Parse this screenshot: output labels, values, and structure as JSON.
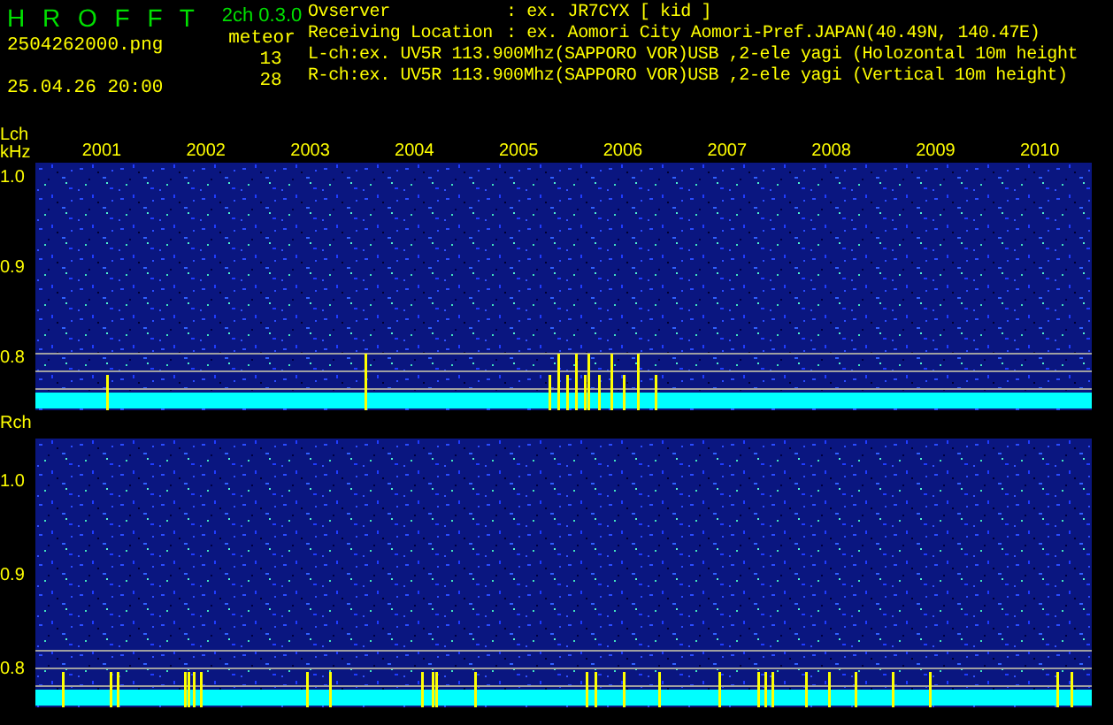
{
  "header": {
    "logo": "H R O F F T",
    "version": "2ch 0.3.0",
    "mode": "meteor",
    "filename": "2504262000.png",
    "timestamp": "25.04.26 20:00",
    "counts": [
      "13",
      "28"
    ]
  },
  "station": [
    {
      "label": "Ovserver",
      "value": ": ex. JR7CYX [ kid ]"
    },
    {
      "label": "Receiving Location",
      "value": ": ex. Aomori City Aomori-Pref.JAPAN(40.49N, 140.47E)"
    }
  ],
  "receivers": [
    "L-ch:ex. UV5R 113.900Mhz(SAPPORO VOR)USB ,2-ele yagi (Holozontal 10m height",
    "R-ch:ex. UV5R 113.900Mhz(SAPPORO VOR)USB ,2-ele yagi (Vertical 10m height)"
  ],
  "time_axis": [
    "2001",
    "2002",
    "2003",
    "2004",
    "2005",
    "2006",
    "2007",
    "2008",
    "2009",
    "2010"
  ],
  "channels": [
    {
      "name": "Lch",
      "unit": "kHz",
      "yticks": [
        "1.0",
        "0.9",
        "0.8"
      ]
    },
    {
      "name": "Rch",
      "yticks": [
        "1.0",
        "0.9",
        "0.8"
      ]
    }
  ]
}
